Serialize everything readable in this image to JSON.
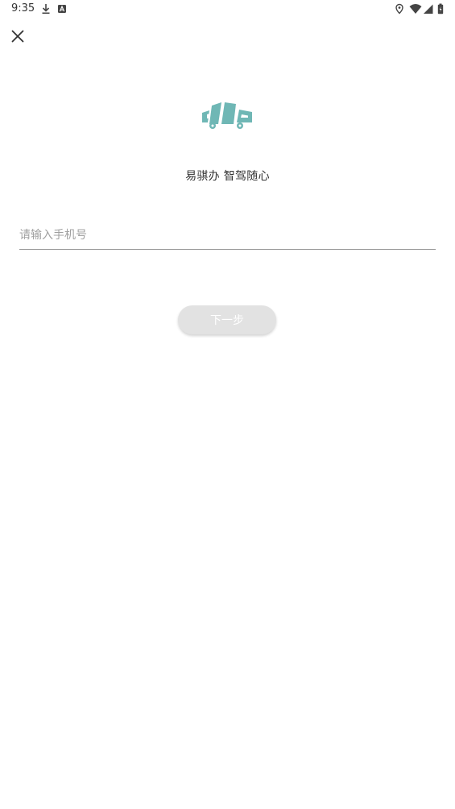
{
  "status_bar": {
    "time": "9:35",
    "icons": [
      "download-icon",
      "notification-a-icon",
      "location-icon",
      "wifi-icon",
      "signal-icon",
      "battery-icon"
    ]
  },
  "header": {
    "close_icon": "close-icon"
  },
  "brand": {
    "logo_icon": "car-logo-icon",
    "accent_color": "#6fb7b5",
    "slogan": "易骐办 智驾随心"
  },
  "login_form": {
    "phone_placeholder": "请输入手机号",
    "phone_value": "",
    "next_label": "下一步",
    "next_button_color": "#e2e2e2"
  }
}
